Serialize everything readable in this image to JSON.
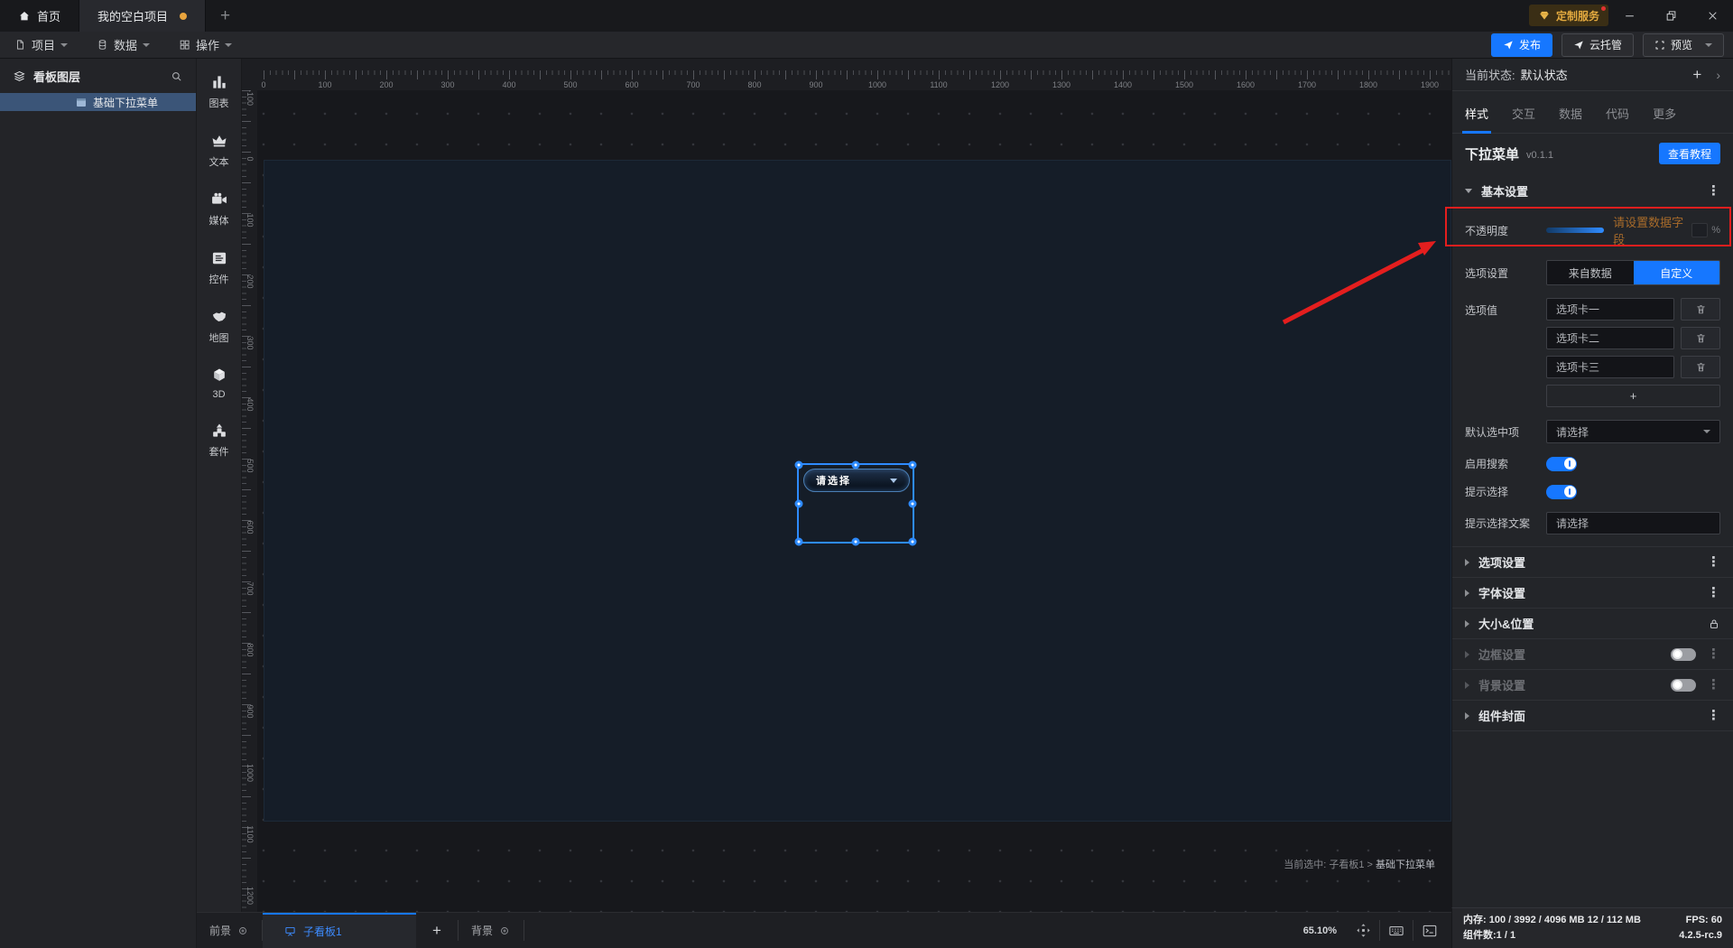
{
  "colors": {
    "accent": "#1677ff",
    "annotation_red": "#e41e1e",
    "hint_amber": "#a86b2a",
    "badge_gold": "#e2a93f",
    "selection_blue": "#2e8bff",
    "unsaved_dot": "#e8a33d"
  },
  "titlebar": {
    "home_label": "首页",
    "project_label": "我的空白项目",
    "add_label": "+",
    "badge_label": "定制服务"
  },
  "menubar": {
    "items": [
      {
        "label": "项目"
      },
      {
        "label": "数据"
      },
      {
        "label": "操作"
      }
    ],
    "publish_label": "发布",
    "cloud_label": "云托管",
    "preview_label": "预览"
  },
  "layers": {
    "title": "看板图层",
    "items": [
      {
        "label": "基础下拉菜单",
        "selected": true
      }
    ]
  },
  "tools": {
    "items": [
      {
        "icon": "chart-icon",
        "label": "图表"
      },
      {
        "icon": "text-icon",
        "label": "文本"
      },
      {
        "icon": "media-icon",
        "label": "媒体"
      },
      {
        "icon": "widget-icon",
        "label": "控件"
      },
      {
        "icon": "map-icon",
        "label": "地图"
      },
      {
        "icon": "cube-icon",
        "label": "3D"
      },
      {
        "icon": "kit-icon",
        "label": "套件"
      }
    ]
  },
  "canvas": {
    "h_labels": [
      "0",
      "100",
      "200",
      "300",
      "400",
      "500",
      "600",
      "700",
      "800",
      "900",
      "1000",
      "1100",
      "1200",
      "1300",
      "1400",
      "1500",
      "1600",
      "1700",
      "1800",
      "1900"
    ],
    "v_labels": [
      "-100",
      "0",
      "100",
      "200",
      "300",
      "400",
      "500",
      "600",
      "700",
      "800",
      "900",
      "1000",
      "1100",
      "1200"
    ],
    "dropdown_placeholder": "请选择",
    "hint_prefix": "当前选中: 子看板1 >",
    "hint_name": "基础下拉菜单"
  },
  "panel": {
    "state_label": "当前状态:",
    "state_value": "默认状态",
    "tabs": [
      {
        "label": "样式",
        "active": true
      },
      {
        "label": "交互",
        "active": false
      },
      {
        "label": "数据",
        "active": false
      },
      {
        "label": "代码",
        "active": false
      },
      {
        "label": "更多",
        "active": false
      }
    ],
    "component_name": "下拉菜单",
    "component_version": "v0.1.1",
    "tutorial_label": "查看教程",
    "basic_title": "基本设置",
    "rows": {
      "opacity_label": "不透明度",
      "opacity_hint": "请设置数据字段",
      "opacity_unit": "%",
      "option_setting_label": "选项设置",
      "seg_from_data": "来自数据",
      "seg_custom": "自定义",
      "option_value_label": "选项值",
      "add_label": "+",
      "default_label": "默认选中项",
      "default_value": "请选择",
      "search_label": "启用搜索",
      "prompt_label": "提示选择",
      "prompt_text_label": "提示选择文案",
      "prompt_text_value": "请选择"
    },
    "option_values": [
      "选项卡一",
      "选项卡二",
      "选项卡三"
    ],
    "sections": [
      {
        "label": "选项设置",
        "right": "kebab",
        "dim": false
      },
      {
        "label": "字体设置",
        "right": "kebab",
        "dim": false
      },
      {
        "label": "大小&位置",
        "right": "lock",
        "dim": false
      },
      {
        "label": "边框设置",
        "right": "toggle",
        "dim": true
      },
      {
        "label": "背景设置",
        "right": "toggle",
        "dim": true
      },
      {
        "label": "组件封面",
        "right": "kebab",
        "dim": false
      }
    ]
  },
  "stats": {
    "memory_label": "内存:",
    "memory_value": "100 / 3992 / 4096 MB  12 / 112 MB",
    "fps_value": "FPS:  60",
    "components_label": "组件数:",
    "components_value": "1 / 1",
    "version": "4.2.5-rc.9"
  },
  "footer": {
    "foreground_label": "前景",
    "board_tab_label": "子看板1",
    "add_label": "+",
    "background_label": "背景",
    "zoom_value": "65.10%"
  }
}
